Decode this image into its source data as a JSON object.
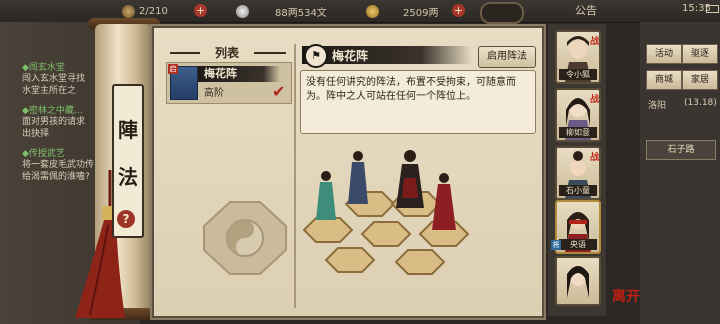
{
  "topbar": {
    "stamina": "2/210",
    "silver": "88两534文",
    "gold": "2509两",
    "notice_label": "公告",
    "clock": "15:35"
  },
  "bg_quests": [
    {
      "title": "◆闯玄水堂",
      "text": "闯入玄水堂寻找\n水堂主所在之"
    },
    {
      "title": "◆密林之中藏…",
      "text": "面对男孩的请求\n出抉择"
    },
    {
      "title": "◆传授武艺",
      "text": "将一套皮毛武功传\n给渴需佩的淮嗑?"
    }
  ],
  "scroll": {
    "vertical_title": [
      "陣",
      "法"
    ],
    "help_label": "?"
  },
  "list": {
    "header": "列表",
    "items": [
      {
        "tag": "启",
        "name": "梅花阵",
        "rank": "高阶",
        "selected": true
      }
    ]
  },
  "formation": {
    "title": "梅花阵",
    "enable_button": "启用阵法",
    "description": "没有任何讲究的阵法，布置不受拘束，可随意而为。阵中之人可站在任何一个阵位上。"
  },
  "characters": [
    {
      "name": "令小狐",
      "badge": "战"
    },
    {
      "name": "柳如意",
      "badge": "战"
    },
    {
      "name": "石小童",
      "badge": "战"
    },
    {
      "name": "央语",
      "badge": "战"
    },
    {
      "name": "",
      "badge": ""
    }
  ],
  "right_menu": {
    "buttons": [
      "活动",
      "驱逐",
      "商城",
      "家居"
    ],
    "location": "石子路",
    "level_text": "洛阳",
    "level_value": "(13.18)"
  },
  "corner_logo": "离开",
  "colors": {
    "accent_red": "#b0281a",
    "paper": "#e8ddc4",
    "dark": "#1c1815"
  }
}
